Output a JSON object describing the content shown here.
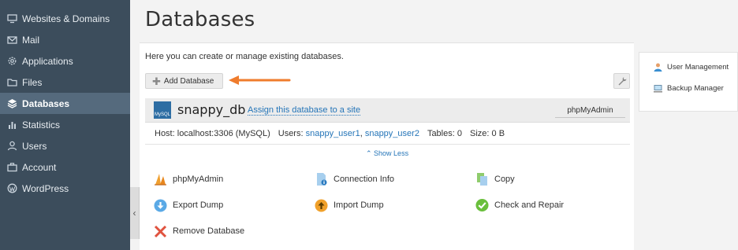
{
  "sidebar": {
    "items": [
      {
        "label": "Websites & Domains",
        "icon": "monitor-icon"
      },
      {
        "label": "Mail",
        "icon": "mail-icon"
      },
      {
        "label": "Applications",
        "icon": "gear-icon"
      },
      {
        "label": "Files",
        "icon": "folder-icon"
      },
      {
        "label": "Databases",
        "icon": "layers-icon",
        "active": true
      },
      {
        "label": "Statistics",
        "icon": "bar-chart-icon"
      },
      {
        "label": "Users",
        "icon": "user-icon"
      },
      {
        "label": "Account",
        "icon": "briefcase-icon"
      },
      {
        "label": "WordPress",
        "icon": "wordpress-icon"
      }
    ],
    "collapse_glyph": "‹"
  },
  "page": {
    "title": "Databases",
    "intro": "Here you can create or manage existing databases."
  },
  "toolbar": {
    "add_database_label": "Add Database"
  },
  "database": {
    "name": "snappy_db",
    "logo_text": "MySQL",
    "assign_link": "Assign this database to a site",
    "phpmyadmin_button": "phpMyAdmin",
    "host_label": "Host:",
    "host_value": "localhost:3306 (MySQL)",
    "users_label": "Users:",
    "user1": "snappy_user1",
    "user_sep": ",",
    "user2": "snappy_user2",
    "tables_label": "Tables:",
    "tables_value": "0",
    "size_label": "Size:",
    "size_value": "0 B",
    "show_less": "⌃ Show Less"
  },
  "tools": {
    "phpmyadmin": "phpMyAdmin",
    "connection_info": "Connection Info",
    "copy": "Copy",
    "export_dump": "Export Dump",
    "import_dump": "Import Dump",
    "check_and_repair": "Check and Repair",
    "remove_database": "Remove Database"
  },
  "right_panel": {
    "user_management": "User Management",
    "backup_manager": "Backup Manager"
  },
  "colors": {
    "sidebar_bg": "#3c4d5c",
    "sidebar_active": "#556a7d",
    "link": "#2575b8",
    "arrow": "#ef7c2d"
  }
}
